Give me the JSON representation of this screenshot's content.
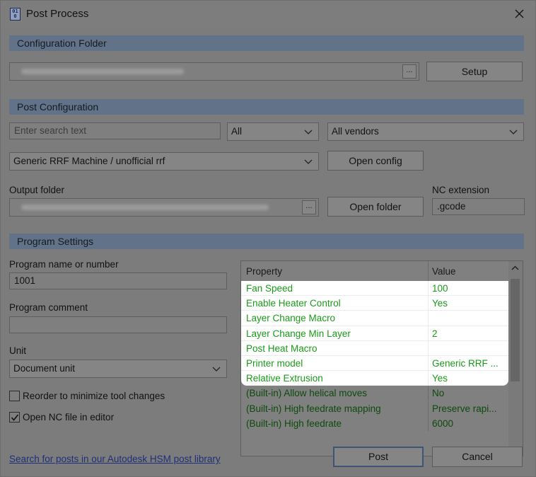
{
  "window": {
    "title": "Post Process",
    "app_icon_text": "01\n0",
    "close_icon": "close-icon"
  },
  "config_folder": {
    "section_title": "Configuration Folder",
    "path_value": "",
    "browse_label": "...",
    "setup_label": "Setup"
  },
  "post_config": {
    "section_title": "Post Configuration",
    "search_placeholder": "Enter search text",
    "capability_selected": "All",
    "vendor_selected": "All vendors",
    "machine_selected": "Generic RRF Machine / unofficial rrf",
    "open_config_label": "Open config",
    "output_folder_label": "Output folder",
    "output_folder_value": "",
    "output_browse_label": "...",
    "open_folder_label": "Open folder",
    "nc_extension_label": "NC extension",
    "nc_extension_value": ".gcode"
  },
  "program_settings": {
    "section_title": "Program Settings",
    "program_name_label": "Program name or number",
    "program_name_value": "1001",
    "program_comment_label": "Program comment",
    "program_comment_value": "",
    "unit_label": "Unit",
    "unit_selected": "Document unit",
    "reorder_label": "Reorder to minimize tool changes",
    "reorder_checked": false,
    "open_nc_label": "Open NC file in editor",
    "open_nc_checked": true
  },
  "properties": {
    "header_property": "Property",
    "header_value": "Value",
    "rows": [
      {
        "property": "Fan Speed",
        "value": "100"
      },
      {
        "property": "Enable Heater Control",
        "value": "Yes"
      },
      {
        "property": "Layer Change Macro",
        "value": ""
      },
      {
        "property": "Layer Change Min Layer",
        "value": "2"
      },
      {
        "property": "Post Heat Macro",
        "value": ""
      },
      {
        "property": "Printer model",
        "value": "Generic RRF ..."
      },
      {
        "property": "Relative Extrusion",
        "value": "Yes"
      },
      {
        "property": "(Built-in) Allow helical moves",
        "value": "No"
      },
      {
        "property": "(Built-in) High feedrate mapping",
        "value": "Preserve rapi..."
      },
      {
        "property": "(Built-in) High feedrate",
        "value": "6000"
      }
    ]
  },
  "footer": {
    "library_link": "Search for posts in our Autodesk HSM post library",
    "post_label": "Post",
    "cancel_label": "Cancel"
  },
  "colors": {
    "highlight_text": "#1a9a1a",
    "section_header": "#627389",
    "overlay_gray": "#7c7c7c"
  }
}
